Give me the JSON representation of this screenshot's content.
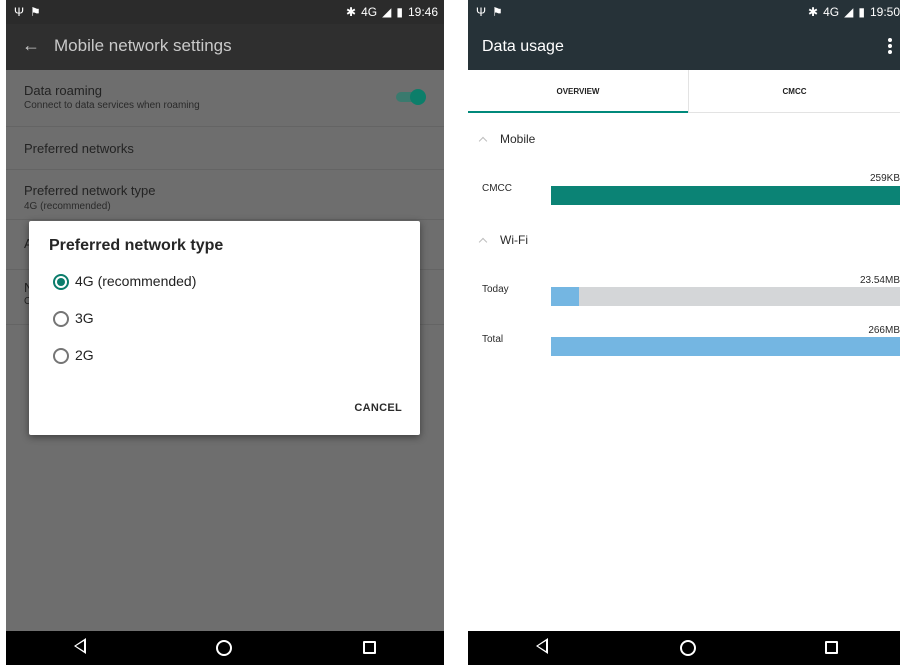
{
  "left_screen": {
    "status_bar": {
      "left_icons": [
        "usb-icon",
        "notification-icon"
      ],
      "network": "4G",
      "time": "19:46"
    },
    "toolbar": {
      "title": "Mobile network settings"
    },
    "settings": {
      "data_roaming": {
        "title": "Data roaming",
        "summary": "Connect to data services when roaming",
        "enabled": true
      },
      "preferred_networks": {
        "title": "Preferred networks"
      },
      "preferred_network_type": {
        "title": "Preferred network type",
        "summary": "4G (recommended)"
      },
      "partial_row_a": "A",
      "partial_row_n": "N",
      "partial_row_n_sub": "C"
    },
    "dialog": {
      "title": "Preferred network type",
      "options": [
        {
          "label": "4G (recommended)",
          "selected": true
        },
        {
          "label": "3G",
          "selected": false
        },
        {
          "label": "2G",
          "selected": false
        }
      ],
      "cancel_label": "CANCEL"
    }
  },
  "right_screen": {
    "status_bar": {
      "left_icons": [
        "usb-icon",
        "notification-icon"
      ],
      "network": "4G",
      "time": "19:50"
    },
    "toolbar": {
      "title": "Data usage"
    },
    "tabs": [
      {
        "label": "OVERVIEW",
        "active": true
      },
      {
        "label": "CMCC",
        "active": false
      }
    ],
    "sections": {
      "mobile": {
        "title": "Mobile",
        "rows": [
          {
            "label": "CMCC",
            "value": "259KB",
            "fraction": 1.0
          }
        ]
      },
      "wifi": {
        "title": "Wi-Fi",
        "rows": [
          {
            "label": "Today",
            "value": "23.54MB",
            "fraction": 0.08
          },
          {
            "label": "Total",
            "value": "266MB",
            "fraction": 1.0
          }
        ]
      }
    }
  },
  "colors": {
    "accent": "#0b7d6c",
    "wifi_bar": "#74b6e2",
    "mobile_bar": "#0b8375",
    "track": "#d4d6d8",
    "dark_toolbar": "#263238"
  }
}
